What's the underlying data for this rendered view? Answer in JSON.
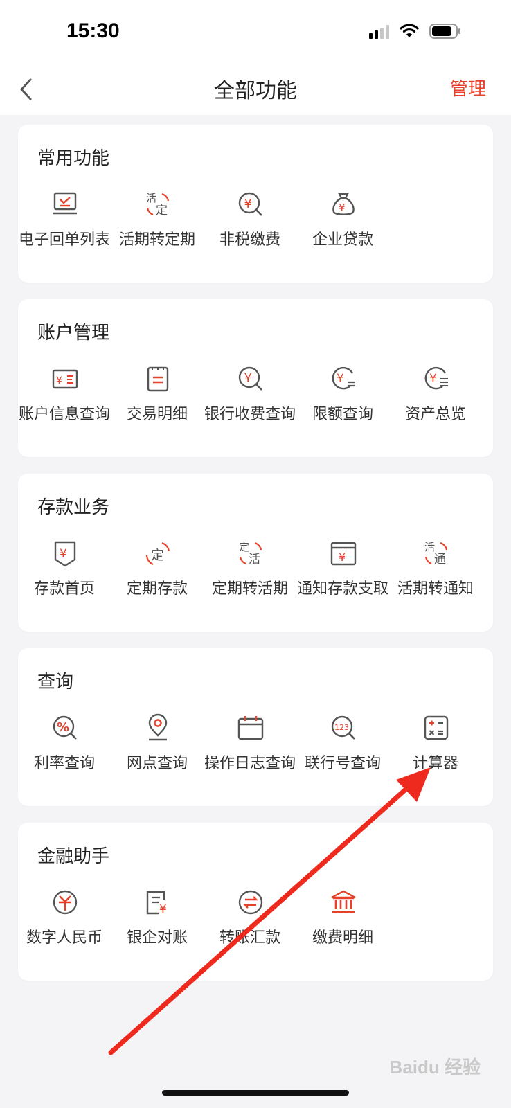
{
  "status_bar": {
    "time": "15:30"
  },
  "nav": {
    "title": "全部功能",
    "manage_label": "管理"
  },
  "colors": {
    "accent": "#e5412b",
    "icon_gray": "#555555"
  },
  "sections": [
    {
      "title": "常用功能",
      "items": [
        {
          "label": "电子回单列表",
          "icon": "receipt-monitor-icon"
        },
        {
          "label": "活期转定期",
          "icon": "current-to-fixed-icon"
        },
        {
          "label": "非税缴费",
          "icon": "yuan-search-icon"
        },
        {
          "label": "企业贷款",
          "icon": "money-bag-icon"
        }
      ]
    },
    {
      "title": "账户管理",
      "items": [
        {
          "label": "账户信息查询",
          "icon": "account-card-icon"
        },
        {
          "label": "交易明细",
          "icon": "clipboard-list-icon"
        },
        {
          "label": "银行收费查询",
          "icon": "yuan-search-icon"
        },
        {
          "label": "限额查询",
          "icon": "yuan-limit-icon"
        },
        {
          "label": "资产总览",
          "icon": "yuan-overview-icon"
        }
      ]
    },
    {
      "title": "存款业务",
      "items": [
        {
          "label": "存款首页",
          "icon": "deposit-shield-icon"
        },
        {
          "label": "定期存款",
          "icon": "fixed-deposit-icon"
        },
        {
          "label": "定期转活期",
          "icon": "fixed-to-current-icon"
        },
        {
          "label": "通知存款支取",
          "icon": "notice-deposit-icon"
        },
        {
          "label": "活期转通知",
          "icon": "current-to-notice-icon"
        }
      ]
    },
    {
      "title": "查询",
      "items": [
        {
          "label": "利率查询",
          "icon": "rate-search-icon"
        },
        {
          "label": "网点查询",
          "icon": "location-pin-icon"
        },
        {
          "label": "操作日志查询",
          "icon": "calendar-icon"
        },
        {
          "label": "联行号查询",
          "icon": "number-search-icon"
        },
        {
          "label": "计算器",
          "icon": "calculator-icon"
        }
      ]
    },
    {
      "title": "金融助手",
      "items": [
        {
          "label": "数字人民币",
          "icon": "digital-rmb-icon"
        },
        {
          "label": "银企对账",
          "icon": "reconciliation-icon"
        },
        {
          "label": "转账汇款",
          "icon": "transfer-icon"
        },
        {
          "label": "缴费明细",
          "icon": "bank-building-icon"
        }
      ]
    }
  ],
  "watermark": "Baidu 经验"
}
